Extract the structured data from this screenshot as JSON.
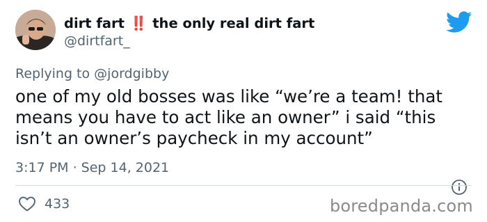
{
  "author": {
    "name_prefix": "dirt fart",
    "name_alert": "‼️",
    "name_suffix": "the only real dirt fart",
    "handle": "@dirtfart_"
  },
  "reply": {
    "prefix": "Replying to",
    "mention": "@jordgibby"
  },
  "tweet": {
    "text_lines": [
      "one of my old bosses was like “we’re a team! that",
      "means you have to act like an owner” i said “this",
      "isn’t an owner’s paycheck in my account”"
    ],
    "timestamp": "3:17 PM · Sep 14, 2021",
    "like_count": "433"
  },
  "watermark": "boredpanda.com",
  "icons": {
    "brand": "twitter-bird-icon",
    "info": "info-icon",
    "like": "heart-icon"
  },
  "colors": {
    "twitter_blue": "#1d9bf0",
    "secondary_text": "#536471",
    "alert_red": "#d42a2a"
  }
}
